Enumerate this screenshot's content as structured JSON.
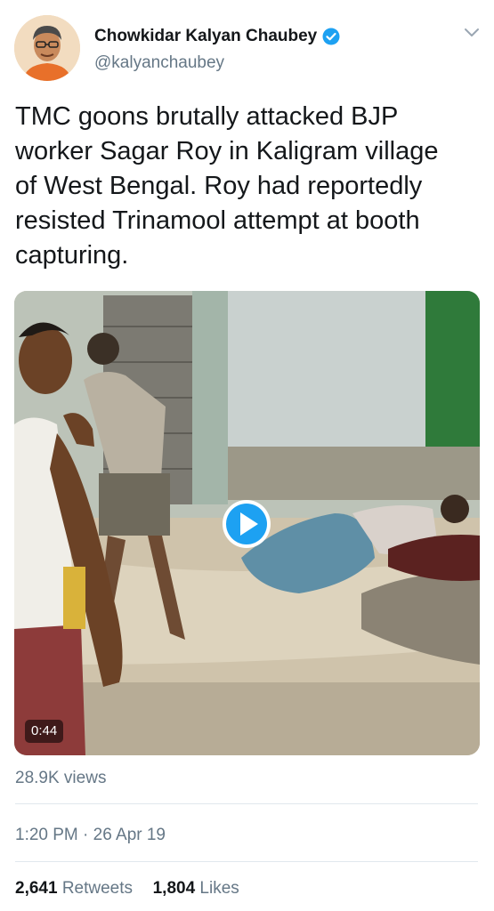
{
  "author": {
    "display_name": "Chowkidar Kalyan Chaubey",
    "handle": "@kalyanchaubey",
    "verified": true
  },
  "tweet": {
    "text_lines": [
      "TMC goons brutally attacked BJP",
      "worker Sagar Roy in Kaligram village",
      "of West Bengal. Roy had reportedly",
      "resisted Trinamool attempt at booth",
      "capturing."
    ]
  },
  "media": {
    "duration": "0:44",
    "play_icon": "play-icon"
  },
  "views": "28.9K views",
  "timestamp": {
    "time": "1:20 PM",
    "separator": "·",
    "date": "26 Apr 19"
  },
  "stats": {
    "retweets_count": "2,641",
    "retweets_label": "Retweets",
    "likes_count": "1,804",
    "likes_label": "Likes"
  },
  "colors": {
    "accent": "#1da1f2",
    "secondary_text": "#657786",
    "primary_text": "#14171a",
    "divider": "#e1e8ed"
  }
}
